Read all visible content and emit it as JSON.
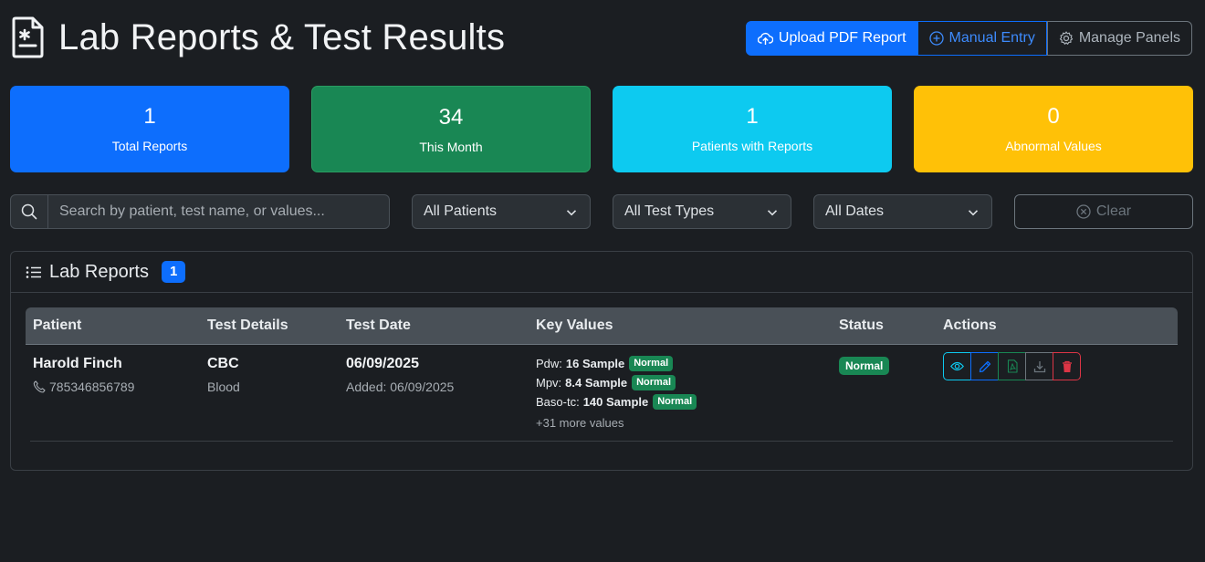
{
  "header": {
    "title": "Lab Reports & Test Results",
    "upload_label": "Upload PDF Report",
    "manual_label": "Manual Entry",
    "panels_label": "Manage Panels"
  },
  "stats": [
    {
      "value": "1",
      "label": "Total Reports",
      "color": "#0d6efd"
    },
    {
      "value": "34",
      "label": "This Month",
      "color": "#198754"
    },
    {
      "value": "1",
      "label": "Patients with Reports",
      "color": "#0dcaf0"
    },
    {
      "value": "0",
      "label": "Abnormal Values",
      "color": "#ffc107"
    }
  ],
  "filters": {
    "search_placeholder": "Search by patient, test name, or values...",
    "patients": "All Patients",
    "test_types": "All Test Types",
    "dates": "All Dates",
    "clear_label": "Clear"
  },
  "reports_card": {
    "title": "Lab Reports",
    "count": "1",
    "columns": [
      "Patient",
      "Test Details",
      "Test Date",
      "Key Values",
      "Status",
      "Actions"
    ],
    "rows": [
      {
        "patient_name": "Harold Finch",
        "patient_phone": "785346856789",
        "test_name": "CBC",
        "test_type": "Blood",
        "test_date": "06/09/2025",
        "added": "Added: 06/09/2025",
        "key_values": [
          {
            "name": "Pdw:",
            "value": "16 Sample",
            "flag": "Normal"
          },
          {
            "name": "Mpv:",
            "value": "8.4 Sample",
            "flag": "Normal"
          },
          {
            "name": "Baso-tc:",
            "value": "140 Sample",
            "flag": "Normal"
          }
        ],
        "more_values": "+31 more values",
        "status": "Normal"
      }
    ]
  }
}
